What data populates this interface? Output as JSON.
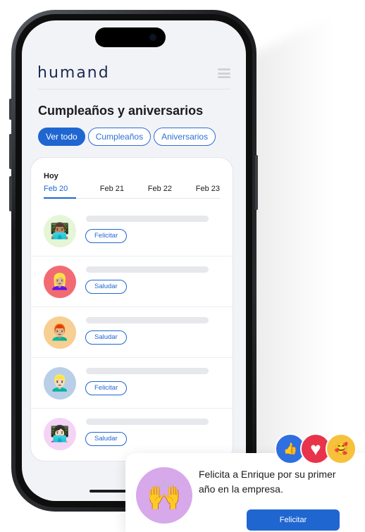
{
  "header": {
    "logo": "humand",
    "title": "Cumpleaños y aniversarios"
  },
  "filters": [
    {
      "label": "Ver todo",
      "active": true
    },
    {
      "label": "Cumpleaños",
      "active": false
    },
    {
      "label": "Aniversarios",
      "active": false
    }
  ],
  "calendar": {
    "today_label": "Hoy",
    "dates": [
      {
        "label": "Feb 20",
        "active": true
      },
      {
        "label": "Feb 21",
        "active": false
      },
      {
        "label": "Feb 22",
        "active": false
      },
      {
        "label": "Feb 23",
        "active": false
      }
    ]
  },
  "people": [
    {
      "emoji": "👨🏽‍💻",
      "bg": "#e5f6d6",
      "action": "Felicitar"
    },
    {
      "emoji": "👱🏼‍♀️",
      "bg": "#f26b73",
      "action": "Saludar"
    },
    {
      "emoji": "👨🏼‍🦰",
      "bg": "#f7cf92",
      "action": "Saludar"
    },
    {
      "emoji": "👱🏻‍♂️",
      "bg": "#b9cfe8",
      "action": "Felicitar"
    },
    {
      "emoji": "👩🏻‍💻",
      "bg": "#f4d4f5",
      "action": "Saludar"
    }
  ],
  "toast": {
    "message": "Felicita a Enrique por su primer año en la empresa.",
    "button": "Felicitar",
    "avatar_emoji": "🙌",
    "avatar_bg": "#d7a8ea"
  },
  "reactions": [
    {
      "name": "like",
      "emoji": "👍",
      "bg": "#2f6fe0"
    },
    {
      "name": "love",
      "emoji": "♥",
      "bg": "#e8334a"
    },
    {
      "name": "care",
      "emoji": "🥰",
      "bg": "#f7c13c"
    }
  ],
  "colors": {
    "accent": "#1f66d1",
    "screen_bg": "#f2f3f6"
  }
}
